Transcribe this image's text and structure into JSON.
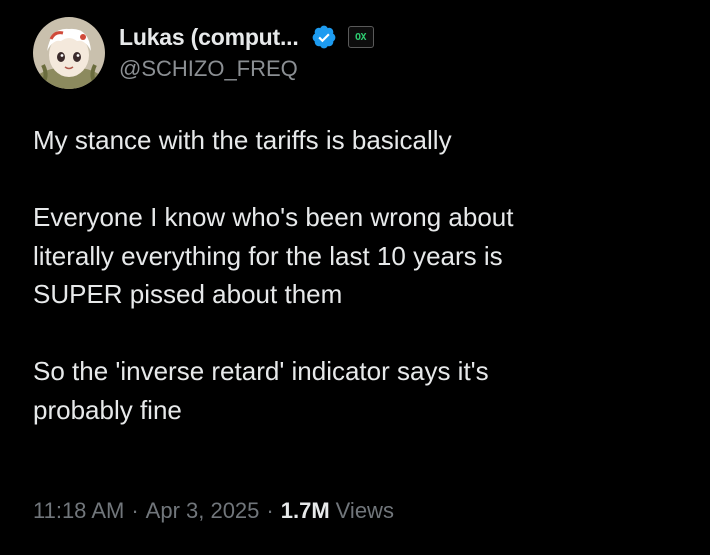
{
  "author": {
    "display_name": "Lukas (comput...",
    "handle": "@SCHIZO_FREQ",
    "avatar_icon": "anime-avatar-icon",
    "verified_icon": "verified-badge-icon",
    "verified_color": "#1d9bf0",
    "affiliate_badge_text": "OX"
  },
  "tweet": {
    "lines": [
      "My stance with the tariffs is basically",
      "",
      "Everyone I know who's been wrong about",
      "literally everything for the last 10 years is",
      "SUPER pissed about them",
      "",
      "So the 'inverse retard' indicator says it's",
      "probably fine"
    ]
  },
  "meta": {
    "time": "11:18 AM",
    "separator": "·",
    "date": "Apr 3, 2025",
    "views_count": "1.7M",
    "views_label": "Views"
  },
  "colors": {
    "background": "#000000",
    "primary_text": "#e7e9ea",
    "secondary_text": "#71767b"
  }
}
